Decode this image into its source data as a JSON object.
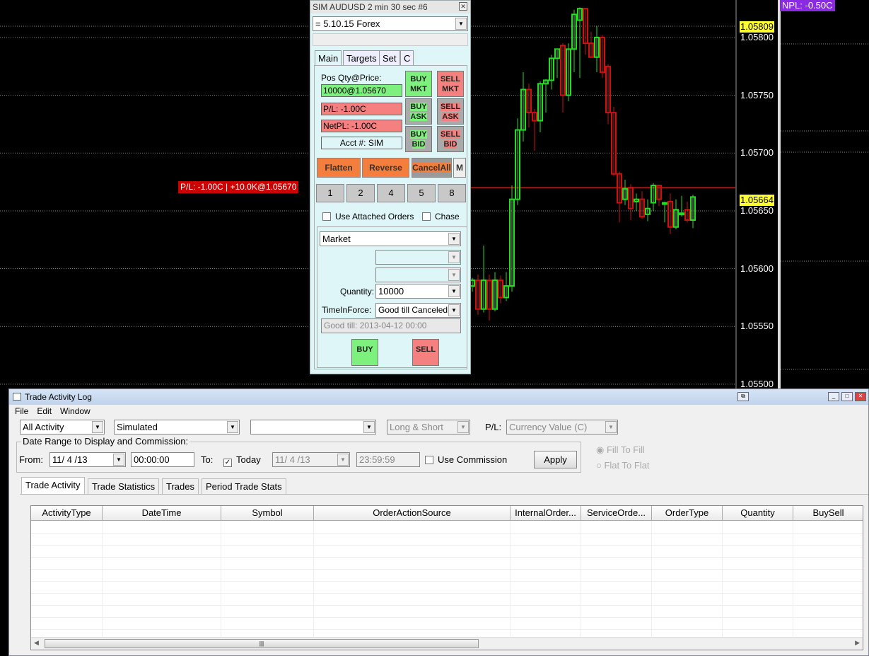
{
  "chart_data": {
    "type": "candlestick",
    "symbol": "AUDUSD",
    "price_ticks": [
      "1.05800",
      "1.05750",
      "1.05700",
      "1.05650",
      "1.05600",
      "1.05550",
      "1.05500"
    ],
    "tick_values": [
      1.058,
      1.0575,
      1.057,
      1.0565,
      1.056,
      1.0555,
      1.055
    ],
    "high_marker": "1.05809",
    "last_price": "1.05664",
    "position_price": 1.0567,
    "position_label": "P/L: -1.00C | +10.0K@1.05670",
    "npl_label": "NPL: -0.50C",
    "candles_ohlc": [
      [
        1.05585,
        1.05592,
        1.0558,
        1.0559
      ],
      [
        1.0559,
        1.05595,
        1.0556,
        1.05565
      ],
      [
        1.05565,
        1.0562,
        1.05562,
        1.0559
      ],
      [
        1.0559,
        1.05595,
        1.05555,
        1.05565
      ],
      [
        1.05565,
        1.05597,
        1.05563,
        1.0559
      ],
      [
        1.0559,
        1.05594,
        1.0557,
        1.05575
      ],
      [
        1.05575,
        1.05597,
        1.05572,
        1.05585
      ],
      [
        1.05585,
        1.05672,
        1.0558,
        1.0566
      ],
      [
        1.0566,
        1.0573,
        1.05655,
        1.0572
      ],
      [
        1.0572,
        1.0577,
        1.0571,
        1.05755
      ],
      [
        1.05755,
        1.0576,
        1.05722,
        1.05735
      ],
      [
        1.05735,
        1.05738,
        1.05702,
        1.05728
      ],
      [
        1.05728,
        1.05762,
        1.05718,
        1.0576
      ],
      [
        1.0576,
        1.05764,
        1.05735,
        1.05763
      ],
      [
        1.05763,
        1.05785,
        1.05755,
        1.05782
      ],
      [
        1.05782,
        1.05789,
        1.05765,
        1.0579
      ],
      [
        1.05793,
        1.05795,
        1.05735,
        1.0575
      ],
      [
        1.0575,
        1.05795,
        1.05745,
        1.0579
      ],
      [
        1.0579,
        1.05824,
        1.0577,
        1.0582
      ],
      [
        1.05815,
        1.05826,
        1.05765,
        1.05825
      ],
      [
        1.05825,
        1.05825,
        1.05785,
        1.05795
      ],
      [
        1.05795,
        1.05805,
        1.05783,
        1.05783
      ],
      [
        1.05783,
        1.0581,
        1.0577,
        1.058
      ],
      [
        1.058,
        1.05802,
        1.05765,
        1.0577
      ],
      [
        1.05775,
        1.05777,
        1.05725,
        1.05735
      ],
      [
        1.05735,
        1.0574,
        1.0568,
        1.05682
      ],
      [
        1.05682,
        1.05684,
        1.0564,
        1.05657
      ],
      [
        1.0566,
        1.05677,
        1.05655,
        1.05669
      ],
      [
        1.0567,
        1.05673,
        1.05642,
        1.05652
      ],
      [
        1.05658,
        1.05665,
        1.0565,
        1.0566
      ],
      [
        1.0566,
        1.05667,
        1.05643,
        1.05645
      ],
      [
        1.05647,
        1.0566,
        1.05641,
        1.05652
      ],
      [
        1.05657,
        1.05674,
        1.0565,
        1.05672
      ],
      [
        1.05672,
        1.05672,
        1.05654,
        1.0566
      ],
      [
        1.05657,
        1.05658,
        1.0564,
        1.05657
      ],
      [
        1.05658,
        1.05665,
        1.0563,
        1.05636
      ],
      [
        1.05636,
        1.0566,
        1.05634,
        1.05651
      ],
      [
        1.05648,
        1.05663,
        1.05645,
        1.05648
      ],
      [
        1.05651,
        1.05658,
        1.0564,
        1.05642
      ],
      [
        1.05642,
        1.05664,
        1.05635,
        1.05662
      ]
    ],
    "up_color": "#22dd22",
    "down_color": "#cc1111"
  },
  "order_dialog": {
    "title": "SIM AUDUSD  2 min 30 sec   #6",
    "strategy": "= 5.10.15 Forex",
    "tabs": [
      "Main",
      "Targets",
      "Set",
      "C"
    ],
    "pos_label": "Pos Qty@Price:",
    "pos_value": "10000@1.05670",
    "pl": "P/L: -1.00C",
    "netpl": "NetPL: -1.00C",
    "acct": "Acct #: SIM",
    "buy_mkt": [
      "BUY",
      "MKT"
    ],
    "sell_mkt": [
      "SELL",
      "MKT"
    ],
    "buy_ask": [
      "BUY",
      "ASK"
    ],
    "sell_ask": [
      "SELL",
      "ASK"
    ],
    "buy_bid": [
      "BUY",
      "BID"
    ],
    "sell_bid": [
      "SELL",
      "BID"
    ],
    "flatten": "Flatten",
    "reverse": "Reverse",
    "cancel_all": "CancelAll",
    "m": "M",
    "qty_buttons": [
      "1",
      "2",
      "4",
      "5",
      "8"
    ],
    "use_attached": "Use Attached Orders",
    "chase": "Chase",
    "order_type": "Market",
    "quantity_label": "Quantity:",
    "quantity": "10000",
    "tif_label": "TimeInForce:",
    "tif": "Good till Canceled",
    "good_till": "Good till: 2013-04-12 00:00",
    "buy": "BUY",
    "sell": "SELL"
  },
  "log": {
    "title": "Trade Activity Log",
    "menu": [
      "File",
      "Edit",
      "Window"
    ],
    "activity": "All Activity",
    "account": "Simulated",
    "symbol": "",
    "side": "Long & Short",
    "pl_label": "P/L:",
    "pl_mode": "Currency Value (C)",
    "date_group": "Date Range to Display and Commission:",
    "from_label": "From:",
    "from_date": "11/ 4 /13",
    "from_time": "00:00:00",
    "to_label": "To:",
    "today": "Today",
    "to_date": "11/ 4 /13",
    "to_time": "23:59:59",
    "use_commission": "Use Commission",
    "apply": "Apply",
    "fill_to_fill": "Fill To Fill",
    "flat_to_flat": "Flat To Flat",
    "tabs": [
      "Trade Activity",
      "Trade Statistics",
      "Trades",
      "Period Trade Stats"
    ],
    "columns": [
      "ActivityType",
      "DateTime",
      "Symbol",
      "OrderActionSource",
      "InternalOrder...",
      "ServiceOrde...",
      "OrderType",
      "Quantity",
      "BuySell"
    ]
  }
}
